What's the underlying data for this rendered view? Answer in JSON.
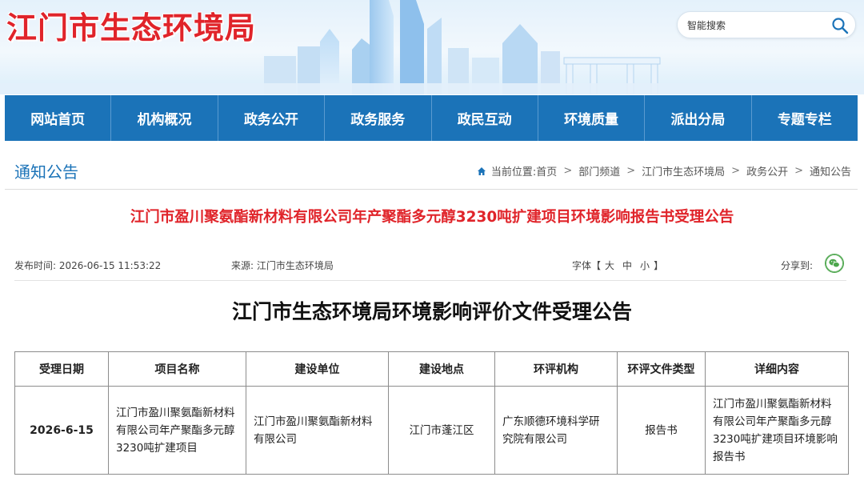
{
  "site": {
    "title": "江门市生态环境局"
  },
  "search": {
    "placeholder": "智能搜索",
    "button_icon": "search-icon"
  },
  "nav": {
    "items": [
      "网站首页",
      "机构概况",
      "政务公开",
      "政务服务",
      "政民互动",
      "环境质量",
      "派出分局",
      "专题专栏"
    ]
  },
  "section": {
    "title": "通知公告"
  },
  "breadcrumb": {
    "prefix": "当前位置:",
    "items": [
      "首页",
      "部门频道",
      "江门市生态环境局",
      "政务公开",
      "通知公告"
    ],
    "separator": ">"
  },
  "article": {
    "title": "江门市盈川聚氨酯新材料有限公司年产聚酯多元醇3230吨扩建项目环境影响报告书受理公告",
    "published": "发布时间:  2026-06-15 11:53:22",
    "source": "来源:  江门市生态环境局",
    "font_label": "字体【",
    "font_large": "大",
    "font_medium": "中",
    "font_small": "小",
    "font_close": "】",
    "share_label": "分享到:",
    "share_icon": "wechat-icon",
    "doc_title": "江门市生态环境局环境影响评价文件受理公告"
  },
  "table": {
    "headers": [
      "受理日期",
      "项目名称",
      "建设单位",
      "建设地点",
      "环评机构",
      "环评文件类型",
      "详细内容"
    ],
    "rows": [
      {
        "date": "2026-6-15",
        "project": "江门市盈川聚氨酯新材料有限公司年产聚酯多元醇3230吨扩建项目",
        "builder": "江门市盈川聚氨酯新材料有限公司",
        "location": "江门市蓬江区",
        "agency": "广东顺德环境科学研究院有限公司",
        "doc_type": "报告书",
        "detail": "江门市盈川聚氨酯新材料有限公司年产聚酯多元醇3230吨扩建项目环境影响报告书"
      }
    ]
  },
  "colors": {
    "brand_red": "#e0242a",
    "nav_blue": "#1b73b8",
    "wechat_green": "#4ca64c"
  }
}
